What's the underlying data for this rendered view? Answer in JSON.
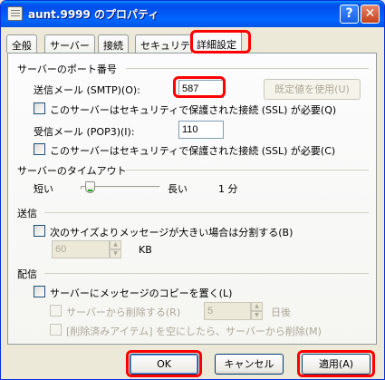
{
  "window": {
    "title": "aunt.9999 のプロパティ",
    "help_label": "?",
    "close_label": "✕"
  },
  "tabs": [
    {
      "label": "全般",
      "active": false
    },
    {
      "label": "サーバー",
      "active": false
    },
    {
      "label": "接続",
      "active": false
    },
    {
      "label": "セキュリティ",
      "active": false
    },
    {
      "label": "詳細設定",
      "active": true
    }
  ],
  "ports": {
    "group_label": "サーバーのポート番号",
    "smtp_label": "送信メール (SMTP)(O):",
    "smtp_value": "587",
    "default_button": "既定値を使用(U)",
    "smtp_ssl_label": "このサーバーはセキュリティで保護された接続 (SSL) が必要(Q)",
    "pop3_label": "受信メール (POP3)(I):",
    "pop3_value": "110",
    "pop3_ssl_label": "このサーバーはセキュリティで保護された接続 (SSL) が必要(C)"
  },
  "timeout": {
    "group_label": "サーバーのタイムアウト",
    "short_label": "短い",
    "long_label": "長い",
    "value_label": "1 分",
    "slider_level": 0.05
  },
  "sending": {
    "group_label": "送信",
    "split_label": "次のサイズよりメッセージが大きい場合は分割する(B)",
    "size_value": "60",
    "size_unit": "KB"
  },
  "delivery": {
    "group_label": "配信",
    "keep_copy_label": "サーバーにメッセージのコピーを置く(L)",
    "remove_after_label": "サーバーから削除する(R)",
    "days_value": "5",
    "days_unit": "日後",
    "remove_deleted_label": "[削除済みアイテム] を空にしたら、サーバーから削除(M)"
  },
  "buttons": {
    "ok": "OK",
    "cancel": "キャンセル",
    "apply": "適用(A)"
  },
  "colors": {
    "highlight": "#ff0000",
    "titlebar": "#0054e3"
  }
}
